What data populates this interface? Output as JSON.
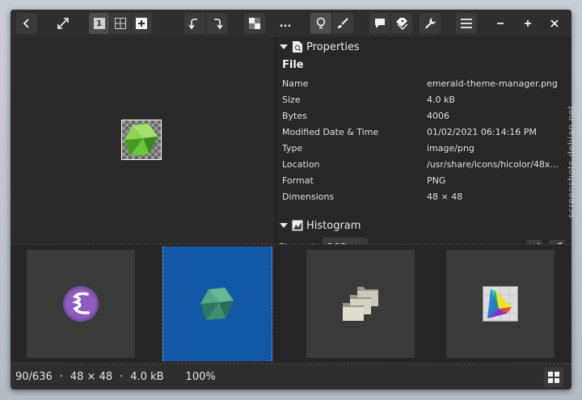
{
  "toolbar": {
    "tooltips": [
      "back",
      "fullscreen",
      "view-single",
      "view-grid",
      "add",
      "rotate-left",
      "rotate-right",
      "transparency",
      "more",
      "properties",
      "edit",
      "comments",
      "tags",
      "tools",
      "menu",
      "minimize",
      "maximize",
      "close"
    ],
    "page_label": "1",
    "more_label": "..."
  },
  "properties": {
    "section_title": "Properties",
    "group_title": "File",
    "rows": [
      {
        "key": "Name",
        "value": "emerald-theme-manager.png"
      },
      {
        "key": "Size",
        "value": "4.0  kB"
      },
      {
        "key": "Bytes",
        "value": "4006"
      },
      {
        "key": "Modified Date & Time",
        "value": "01/02/2021 06:14:16 PM"
      },
      {
        "key": "Type",
        "value": "image/png"
      },
      {
        "key": "Location",
        "value": "/usr/share/icons/hicolor/48x..."
      },
      {
        "key": "Format",
        "value": "PNG"
      },
      {
        "key": "Dimensions",
        "value": "48 × 48"
      }
    ]
  },
  "histogram": {
    "section_title": "Histogram",
    "channel_label": "Channel:",
    "channel_value": "RGB"
  },
  "strip": {
    "items": [
      "emacs-icon",
      "emerald-icon",
      "folders-icon",
      "color-gamut-icon"
    ],
    "selected_index": 1
  },
  "status": {
    "position": "90/636",
    "dimensions": "48 × 48",
    "size": "4.0  kB",
    "zoom": "100%",
    "separator": "·"
  },
  "watermark": "screenshots.debian.net",
  "colors": {
    "selection": "#1358a6",
    "background": "#2b2b2b",
    "emerald": "#6bc33a"
  }
}
